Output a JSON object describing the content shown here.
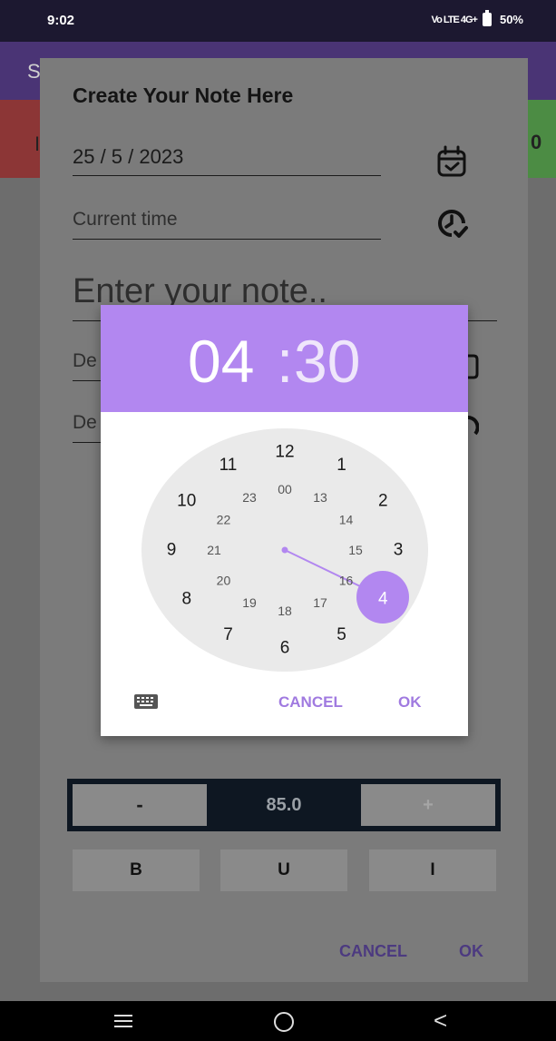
{
  "status_bar": {
    "time": "9:02",
    "network": "Vo LTE 4G+",
    "battery": "50%"
  },
  "background_app": {
    "title_fragment": "S",
    "left_fragment": "I",
    "right_fragment": "0"
  },
  "note_dialog": {
    "title": "Create Your Note Here",
    "date_value": "25 / 5 / 2023",
    "time_placeholder": "Current time",
    "note_placeholder": "Enter your note..",
    "desc_field_1_fragment": "De",
    "desc_field_2_fragment": "De",
    "font_size": {
      "minus": "-",
      "value": "85.0",
      "plus": "+"
    },
    "format_buttons": {
      "bold": "B",
      "underline": "U",
      "italic": "I"
    },
    "cancel": "CANCEL",
    "ok": "OK"
  },
  "time_picker": {
    "hour": "04",
    "minute": "30",
    "separator": ":",
    "selected_hour": 4,
    "outer_numbers": [
      "12",
      "1",
      "2",
      "3",
      "4",
      "5",
      "6",
      "7",
      "8",
      "9",
      "10",
      "11"
    ],
    "inner_numbers": [
      "00",
      "13",
      "14",
      "15",
      "16",
      "17",
      "18",
      "19",
      "20",
      "21",
      "22",
      "23"
    ],
    "cancel": "CANCEL",
    "ok": "OK",
    "accent_color": "#b287f0"
  },
  "nav_bar": {
    "icons": [
      "menu-icon",
      "home-icon",
      "back-icon"
    ]
  }
}
